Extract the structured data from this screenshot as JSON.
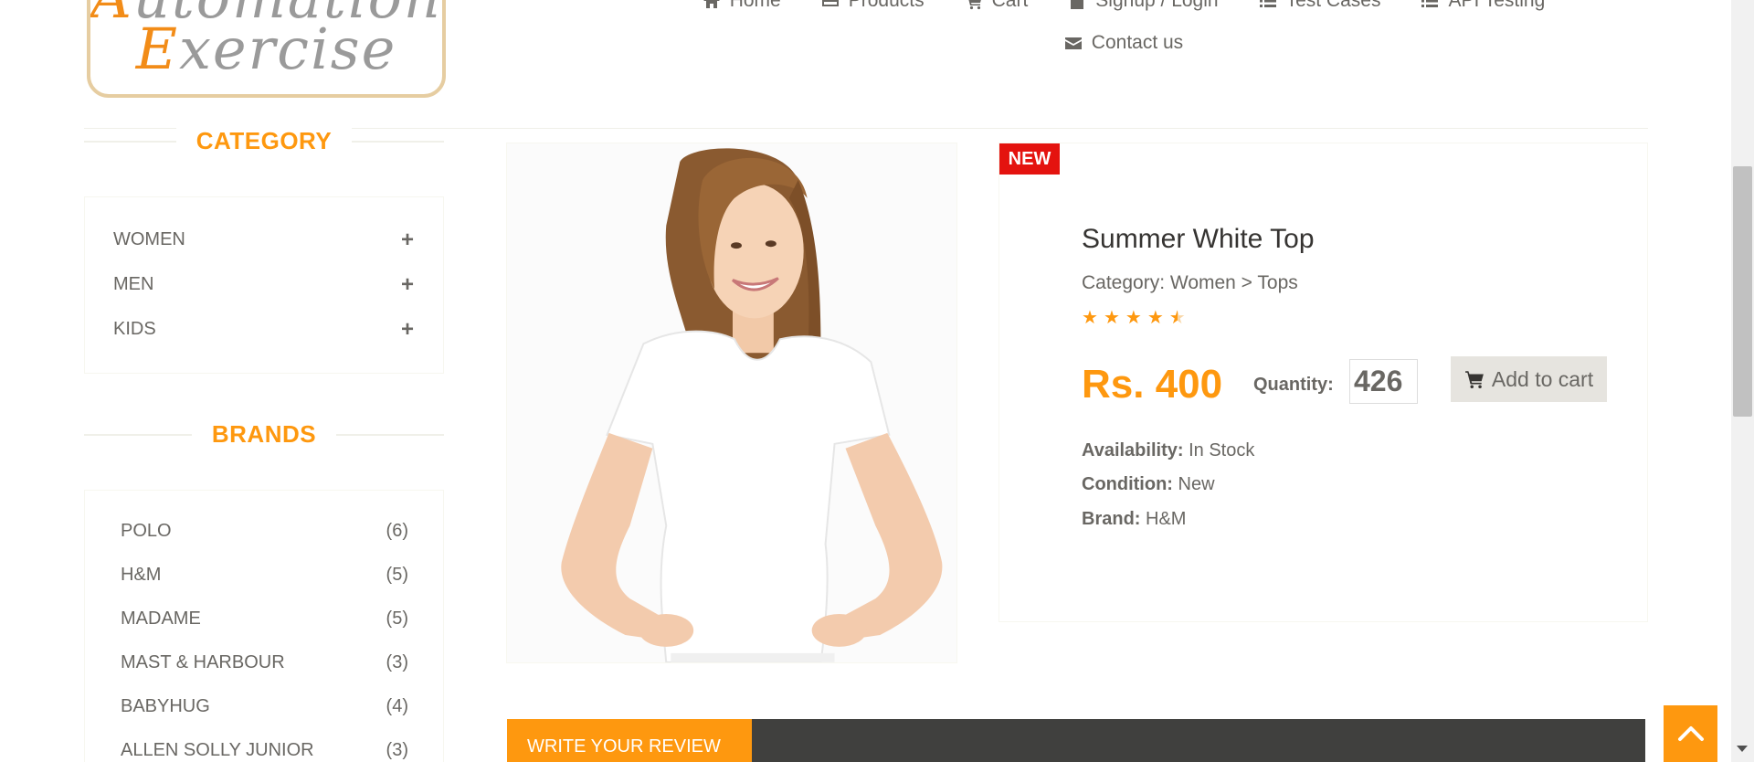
{
  "logo": {
    "line1_accent": "A",
    "line1_rest": "utomation",
    "line2_accent": "E",
    "line2_rest": "xercise"
  },
  "nav": {
    "items": [
      {
        "label": "Home",
        "icon": "home-icon"
      },
      {
        "label": "Products",
        "icon": "card-icon"
      },
      {
        "label": "Cart",
        "icon": "cart-icon"
      },
      {
        "label": "Signup / Login",
        "icon": "lock-icon"
      },
      {
        "label": "Test Cases",
        "icon": "list-icon"
      },
      {
        "label": "API Testing",
        "icon": "list-icon"
      },
      {
        "label": "Contact us",
        "icon": "envelope-icon"
      }
    ]
  },
  "sidebar": {
    "category_title": "CATEGORY",
    "categories": [
      {
        "label": "WOMEN",
        "toggle": "+"
      },
      {
        "label": "MEN",
        "toggle": "+"
      },
      {
        "label": "KIDS",
        "toggle": "+"
      }
    ],
    "brands_title": "BRANDS",
    "brands": [
      {
        "label": "POLO",
        "count": "(6)"
      },
      {
        "label": "H&M",
        "count": "(5)"
      },
      {
        "label": "MADAME",
        "count": "(5)"
      },
      {
        "label": "MAST & HARBOUR",
        "count": "(3)"
      },
      {
        "label": "BABYHUG",
        "count": "(4)"
      },
      {
        "label": "ALLEN SOLLY JUNIOR",
        "count": "(3)"
      }
    ]
  },
  "product": {
    "badge": "NEW",
    "name": "Summer White Top",
    "category": "Category: Women > Tops",
    "rating": 4.5,
    "price": "Rs. 400",
    "quantity_label": "Quantity:",
    "quantity_value": "426",
    "add_to_cart_label": "Add to cart",
    "availability_label": "Availability:",
    "availability_value": "In Stock",
    "condition_label": "Condition:",
    "condition_value": "New",
    "brand_label": "Brand:",
    "brand_value": "H&M"
  },
  "review": {
    "tab_label": "WRITE YOUR REVIEW"
  },
  "colors": {
    "accent": "#fe980f",
    "badge_red": "#e4130f",
    "text": "#696763",
    "dark_bar": "#40403e"
  }
}
